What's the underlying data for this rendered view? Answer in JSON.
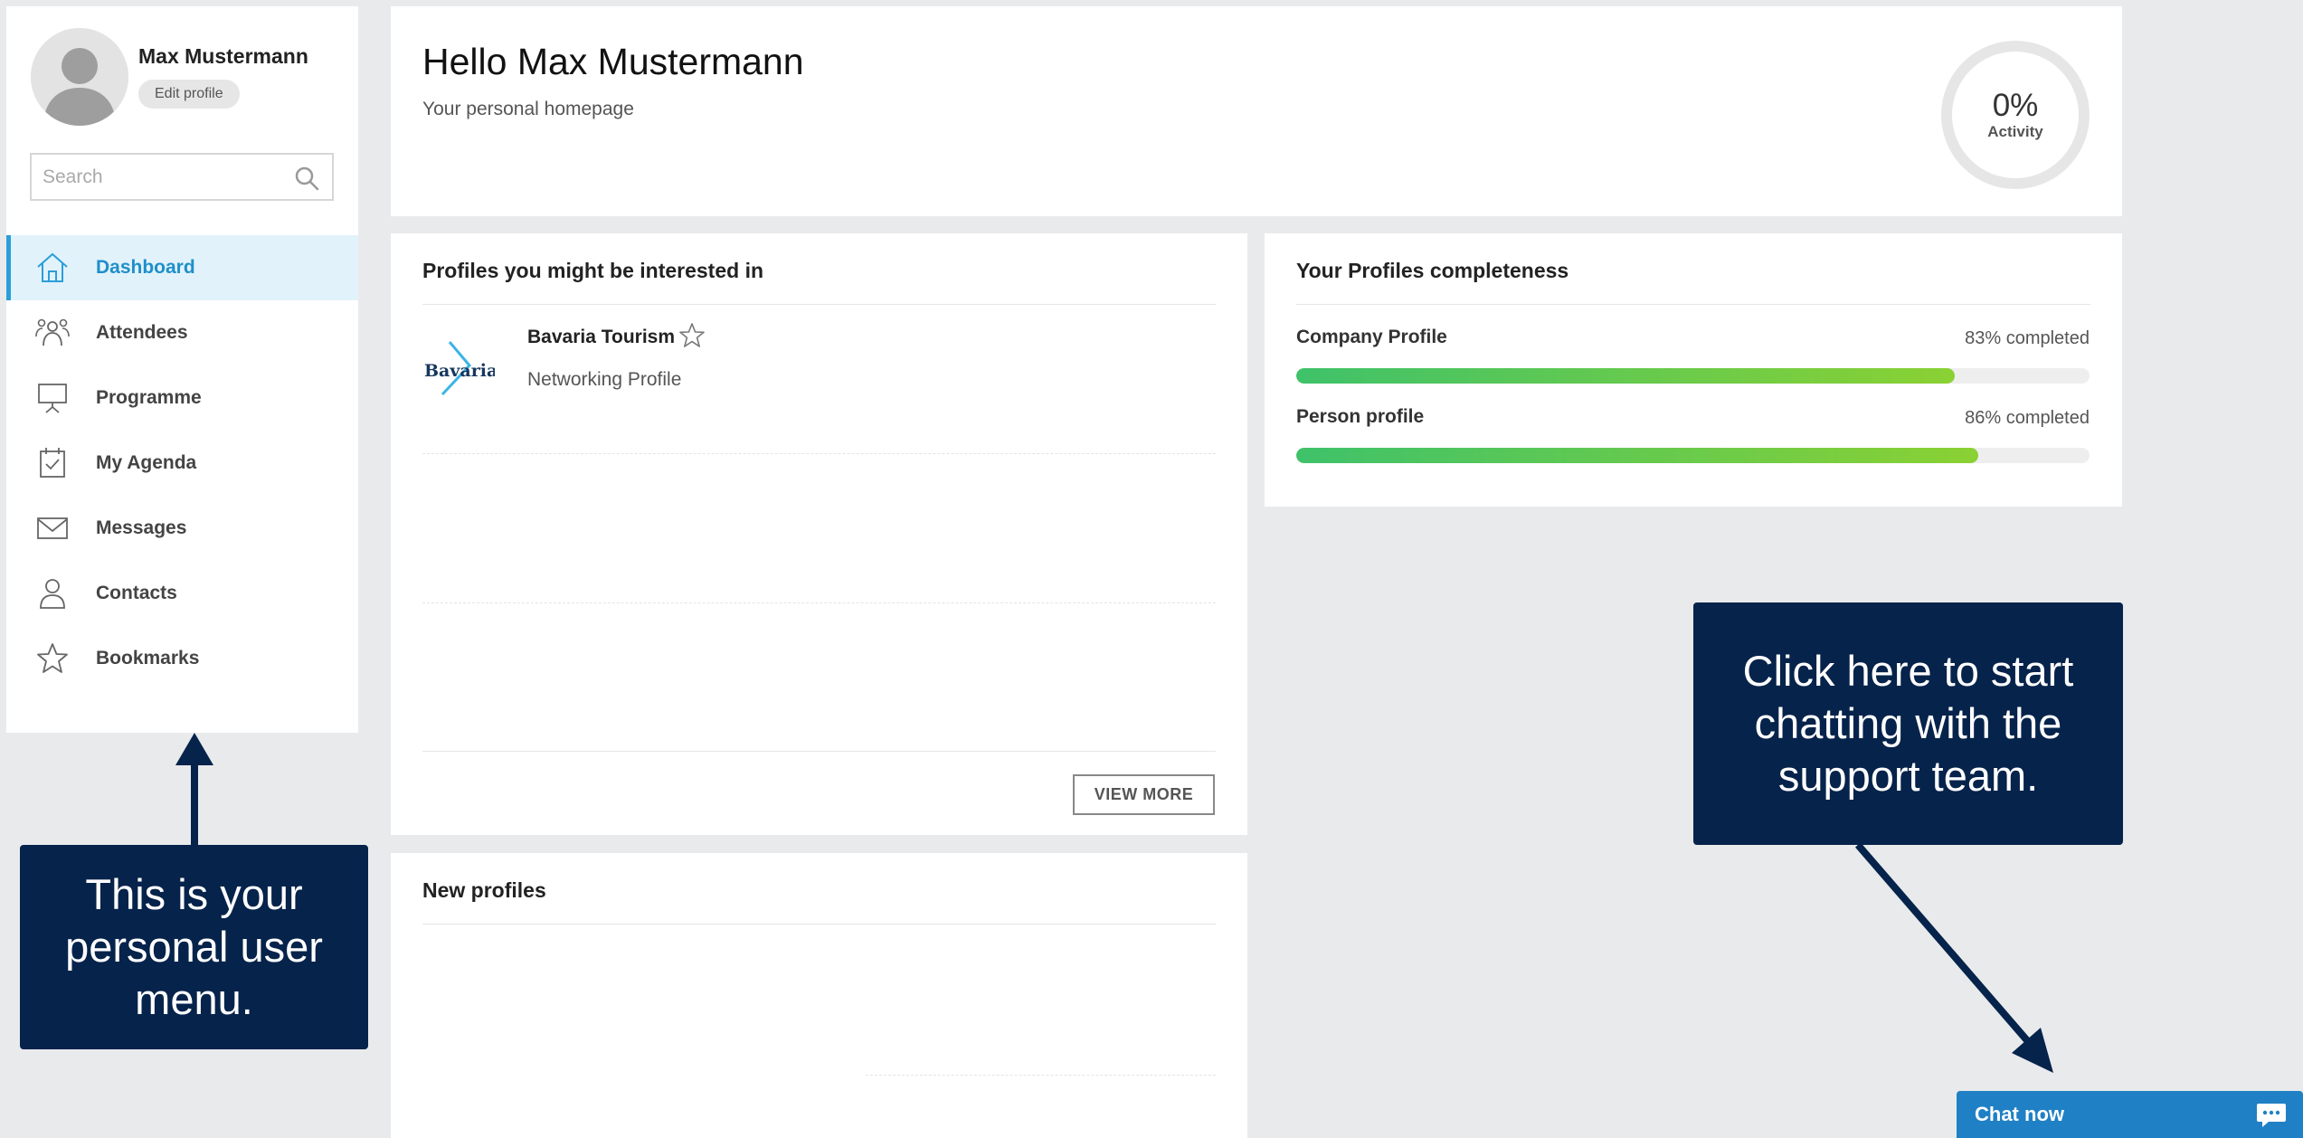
{
  "user": {
    "name": "Max Mustermann",
    "edit_profile_label": "Edit profile"
  },
  "search": {
    "placeholder": "Search"
  },
  "nav": {
    "items": [
      {
        "label": "Dashboard",
        "icon": "home-icon",
        "active": true
      },
      {
        "label": "Attendees",
        "icon": "people-icon"
      },
      {
        "label": "Programme",
        "icon": "presentation-icon"
      },
      {
        "label": "My Agenda",
        "icon": "calendar-check-icon"
      },
      {
        "label": "Messages",
        "icon": "envelope-icon"
      },
      {
        "label": "Contacts",
        "icon": "person-icon"
      },
      {
        "label": "Bookmarks",
        "icon": "star-icon"
      }
    ]
  },
  "header": {
    "greeting": "Hello Max Mustermann",
    "subtitle": "Your personal homepage",
    "activity_value": "0%",
    "activity_label": "Activity"
  },
  "interested": {
    "title": "Profiles you might be interested in",
    "profiles": [
      {
        "name": "Bavaria Tourism",
        "type": "Networking Profile",
        "logo_text": "Bavaria"
      }
    ],
    "view_more_label": "VIEW MORE"
  },
  "completeness": {
    "title": "Your Profiles completeness",
    "rows": [
      {
        "label": "Company Profile",
        "percent": 83,
        "status": "83% completed"
      },
      {
        "label": "Person profile",
        "percent": 86,
        "status": "86% completed"
      }
    ]
  },
  "new_profiles": {
    "title": "New profiles"
  },
  "callouts": {
    "menu": "This is your personal user menu.",
    "chat": "Click here to start chatting with the support team."
  },
  "chat": {
    "label": "Chat now"
  },
  "colors": {
    "accent": "#1f8fc9",
    "callout_bg": "#06234b",
    "chat_button": "#1f80c5",
    "progress_start": "#3fc26a",
    "progress_end": "#8ad133"
  }
}
